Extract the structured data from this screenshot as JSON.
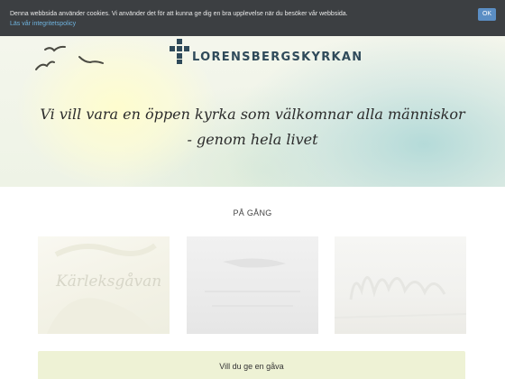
{
  "cookie": {
    "text": "Denna webbsida använder cookies. Vi använder det för att kunna ge dig en bra upplevelse när du besöker vår webbsida.",
    "link_label": "Läs vår integritetspolicy",
    "ok_label": "OK",
    "bg_color": "#3c3f42",
    "link_color": "#6fb3de",
    "button_color": "#5b8ec4"
  },
  "header": {
    "logo_text": "LORENSBERGSKYRKAN",
    "logo_icon": "cross-icon",
    "birds_icon": "birds-icon",
    "tagline_line1": "Vi vill vara en öppen kyrka som välkomnar alla människor",
    "tagline_line2": "- genom hela livet"
  },
  "section": {
    "title": "PÅ GÅNG"
  },
  "cards": [
    {
      "title": "Kärleksgåvan",
      "subtitle": ""
    },
    {
      "title": ""
    },
    {
      "title": ""
    }
  ],
  "gift": {
    "title": "Vill du ge en gåva",
    "bg_color": "#eef2d5"
  }
}
